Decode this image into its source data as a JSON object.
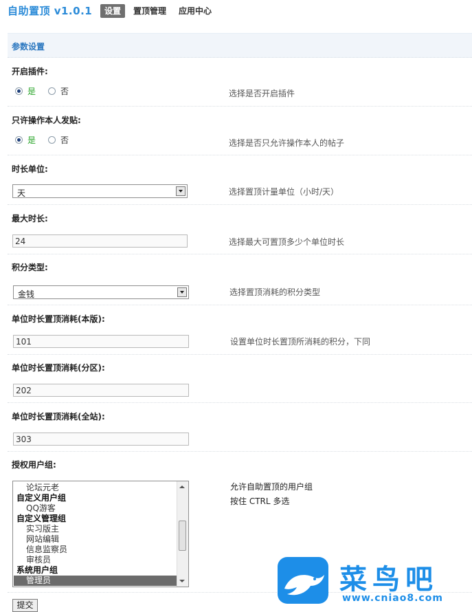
{
  "app": {
    "title": "自助置顶 v1.0.1"
  },
  "nav": {
    "tabs": [
      {
        "label": "设置",
        "active": true
      },
      {
        "label": "置顶管理",
        "active": false
      },
      {
        "label": "应用中心",
        "active": false
      }
    ]
  },
  "section": {
    "title": "参数设置"
  },
  "fields": {
    "enable_plugin": {
      "label": "开启插件:",
      "options": [
        "是",
        "否"
      ],
      "selected": "是",
      "hint": "选择是否开启插件"
    },
    "only_own": {
      "label": "只许操作本人发贴:",
      "options": [
        "是",
        "否"
      ],
      "selected": "是",
      "hint": "选择是否只允许操作本人的帖子"
    },
    "time_unit": {
      "label": "时长单位:",
      "value": "天",
      "hint": "选择置顶计量单位（小时/天）"
    },
    "max_duration": {
      "label": "最大时长:",
      "value": "24",
      "hint": "选择最大可置顶多少个单位时长"
    },
    "credit_type": {
      "label": "积分类型:",
      "value": "金钱",
      "hint": "选择置顶消耗的积分类型"
    },
    "cost_board": {
      "label": "单位时长置顶消耗(本版):",
      "value": "101",
      "hint": "设置单位时长置顶所消耗的积分，下同"
    },
    "cost_zone": {
      "label": "单位时长置顶消耗(分区):",
      "value": "202"
    },
    "cost_site": {
      "label": "单位时长置顶消耗(全站):",
      "value": "303"
    },
    "groups": {
      "label": "授权用户组:",
      "hint_line1": "允许自助置顶的用户组",
      "hint_line2": "按住 CTRL 多选",
      "items": [
        {
          "text": "论坛元老",
          "type": "option",
          "selected": false
        },
        {
          "text": "自定义用户组",
          "type": "group",
          "selected": false
        },
        {
          "text": "QQ游客",
          "type": "option",
          "selected": false
        },
        {
          "text": "自定义管理组",
          "type": "group",
          "selected": false
        },
        {
          "text": "实习版主",
          "type": "option",
          "selected": false
        },
        {
          "text": "网站编辑",
          "type": "option",
          "selected": false
        },
        {
          "text": "信息监察员",
          "type": "option",
          "selected": false
        },
        {
          "text": "审核员",
          "type": "option",
          "selected": false
        },
        {
          "text": "系统用户组",
          "type": "group",
          "selected": false
        },
        {
          "text": "管理员",
          "type": "option",
          "selected": true
        }
      ]
    }
  },
  "submit_label": "提交",
  "watermark": {
    "text": "菜鸟吧",
    "url": "www.cniao8.com"
  },
  "colors": {
    "title_blue": "#2b8bd8",
    "section_bg": "#f1f5fa",
    "yes_green": "#2aa52a",
    "watermark_blue": "#1d8ee8"
  },
  "icons": {
    "watermark_logo": "bird-logo-icon"
  }
}
